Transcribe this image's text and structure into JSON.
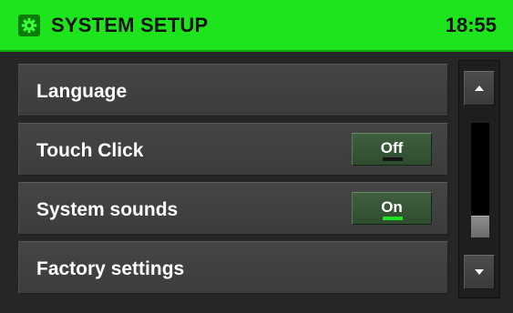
{
  "header": {
    "icon": "settings-gear-icon",
    "title": "SYSTEM SETUP",
    "time": "18:55",
    "color": "#1de41d"
  },
  "menu": {
    "items": [
      {
        "label": "Language"
      },
      {
        "label": "Touch Click",
        "toggle": "Off",
        "state": "off"
      },
      {
        "label": "System sounds",
        "toggle": "On",
        "state": "on"
      },
      {
        "label": "Factory settings"
      }
    ]
  },
  "scrollbar": {
    "up_icon": "arrow-up-icon",
    "down_icon": "arrow-down-icon",
    "position_fraction": 1.0,
    "visible_fraction": 0.2
  }
}
